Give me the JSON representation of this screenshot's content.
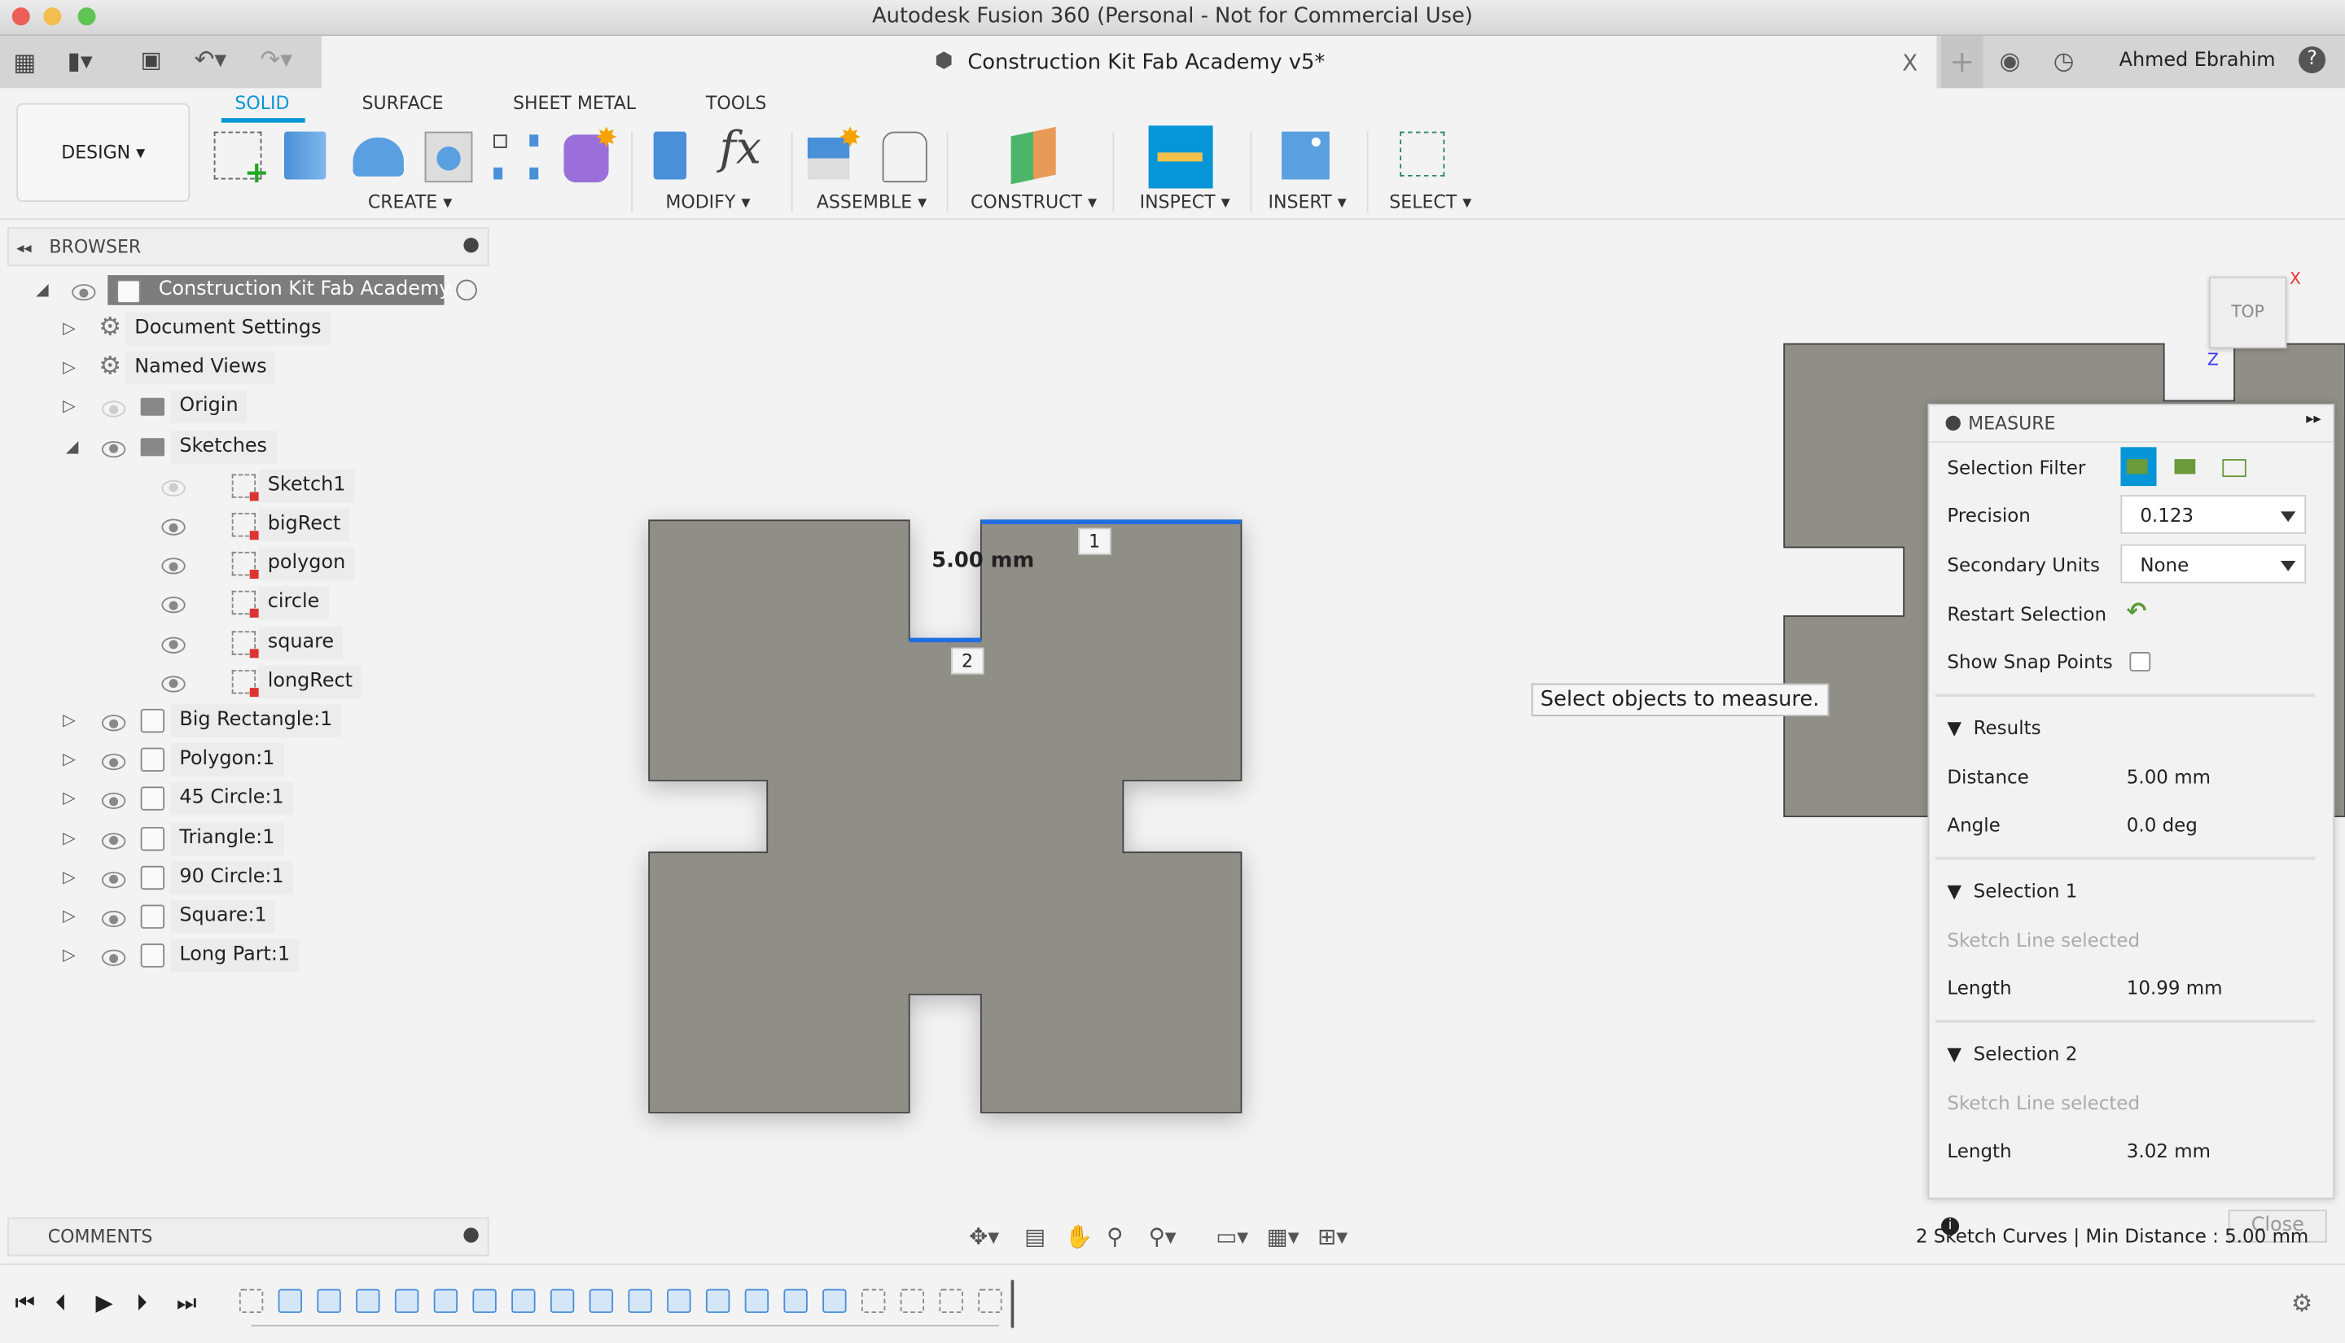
{
  "window": {
    "title": "Autodesk Fusion 360 (Personal - Not for Commercial Use)"
  },
  "document_tab": {
    "title": "Construction Kit Fab Academy v5*",
    "close": "X"
  },
  "user": {
    "name": "Ahmed Ebrahim"
  },
  "workspace": {
    "label": "DESIGN ▾"
  },
  "ribbon": {
    "tabs": [
      {
        "label": "SOLID",
        "active": true
      },
      {
        "label": "SURFACE"
      },
      {
        "label": "SHEET METAL"
      },
      {
        "label": "TOOLS"
      }
    ],
    "groups": [
      "CREATE ▾",
      "MODIFY ▾",
      "ASSEMBLE ▾",
      "CONSTRUCT ▾",
      "INSPECT ▾",
      "INSERT ▾",
      "SELECT ▾"
    ],
    "accent": "#0696d7"
  },
  "browser": {
    "title": "BROWSER",
    "root": "Construction Kit Fab Academy...",
    "items": [
      "Document Settings",
      "Named Views",
      "Origin",
      "Sketches"
    ],
    "sketches": [
      "Sketch1",
      "bigRect",
      "polygon",
      "circle",
      "square",
      "longRect"
    ],
    "bodies": [
      "Big Rectangle:1",
      "Polygon:1",
      "45 Circle:1",
      "Triangle:1",
      "90 Circle:1",
      "Square:1",
      "Long Part:1"
    ]
  },
  "comments": {
    "title": "COMMENTS"
  },
  "viewport": {
    "dimension_label": "5.00 mm",
    "marker1": "1",
    "marker2": "2",
    "tooltip": "Select objects to measure.",
    "viewcube": "TOP",
    "axis_x": "X",
    "axis_z": "Z",
    "selection_color": "#1f6fe0",
    "body_color": "#8f8e87"
  },
  "measure": {
    "title": "MEASURE",
    "selection_filter": "Selection Filter",
    "precision_label": "Precision",
    "precision_value": "0.123",
    "secondary_units_label": "Secondary Units",
    "secondary_units_value": "None",
    "restart_selection": "Restart Selection",
    "show_snap_points": "Show Snap Points",
    "show_snap_points_checked": false,
    "results": {
      "title": "Results",
      "distance_label": "Distance",
      "distance": "5.00 mm",
      "angle_label": "Angle",
      "angle": "0.0 deg"
    },
    "selection1": {
      "title": "Selection 1",
      "desc": "Sketch Line selected",
      "length_label": "Length",
      "length": "10.99 mm"
    },
    "selection2": {
      "title": "Selection 2",
      "desc": "Sketch Line selected",
      "length_label": "Length",
      "length": "3.02 mm"
    },
    "close": "Close"
  },
  "status": {
    "text": "2 Sketch Curves | Min Distance : 5.00 mm"
  }
}
